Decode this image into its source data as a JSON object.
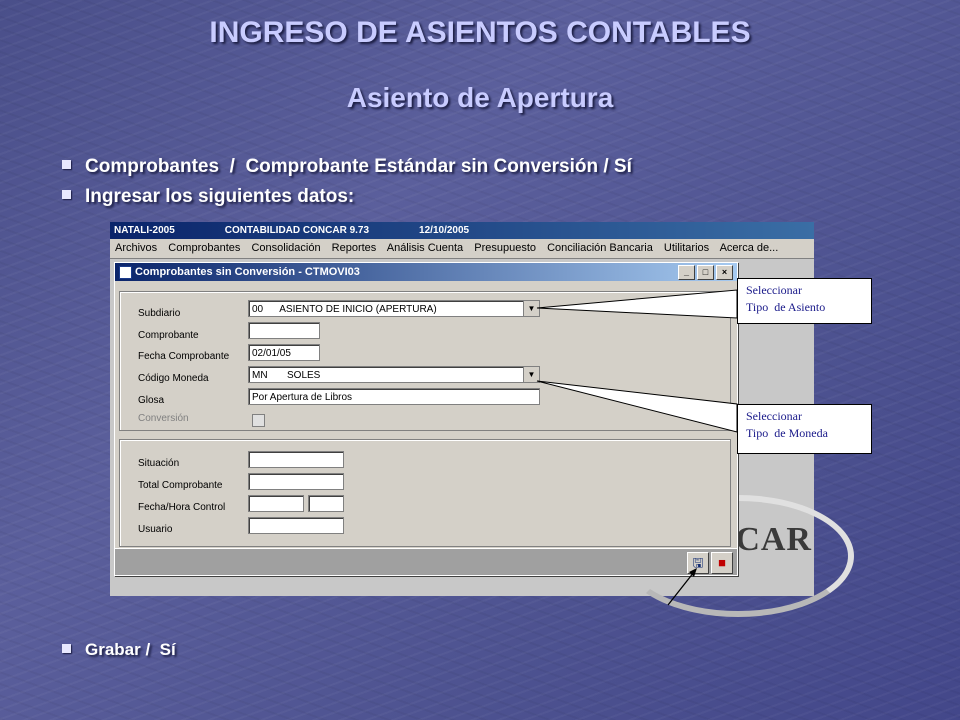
{
  "slide": {
    "title": "INGRESO DE ASIENTOS CONTABLES",
    "subtitle": "Asiento de Apertura",
    "bullets": [
      "Comprobantes  /  Comprobante Estándar sin Conversión / Sí",
      "Ingresar los siguientes datos:",
      "Grabar /  Sí"
    ]
  },
  "app": {
    "title_parts": [
      "NATALI-2005",
      "CONTABILIDAD CONCAR 9.73",
      "12/10/2005"
    ],
    "menu": [
      "Archivos",
      "Comprobantes",
      "Consolidación",
      "Reportes",
      "Análisis Cuenta",
      "Presupuesto",
      "Conciliación Bancaria",
      "Utilitarios",
      "Acerca de..."
    ],
    "logo_text": "CAR"
  },
  "dialog": {
    "title": "Comprobantes sin Conversión - CTMOVI03",
    "window_buttons": [
      "_",
      "□",
      "×"
    ],
    "labels": {
      "subdiario": "Subdiario",
      "comprobante": "Comprobante",
      "fecha": "Fecha Comprobante",
      "moneda": "Código Moneda",
      "glosa": "Glosa",
      "conversion": "Conversión",
      "situacion": "Situación",
      "total": "Total Comprobante",
      "fecha_hora": "Fecha/Hora Control",
      "usuario": "Usuario"
    },
    "values": {
      "subdiario": "00      ASIENTO DE INICIO (APERTURA)",
      "comprobante": "",
      "fecha": "02/01/05",
      "moneda": "MN       SOLES",
      "glosa": "Por Apertura de Libros",
      "situacion": "",
      "total": "",
      "fecha_ctrl": "",
      "hora_ctrl": "",
      "usuario": ""
    },
    "icons": {
      "save": "save-icon",
      "exit": "exit-icon"
    }
  },
  "callouts": {
    "asiento": [
      "Seleccionar",
      "Tipo  de Asiento"
    ],
    "moneda": [
      "Seleccionar",
      "Tipo  de Moneda"
    ]
  }
}
